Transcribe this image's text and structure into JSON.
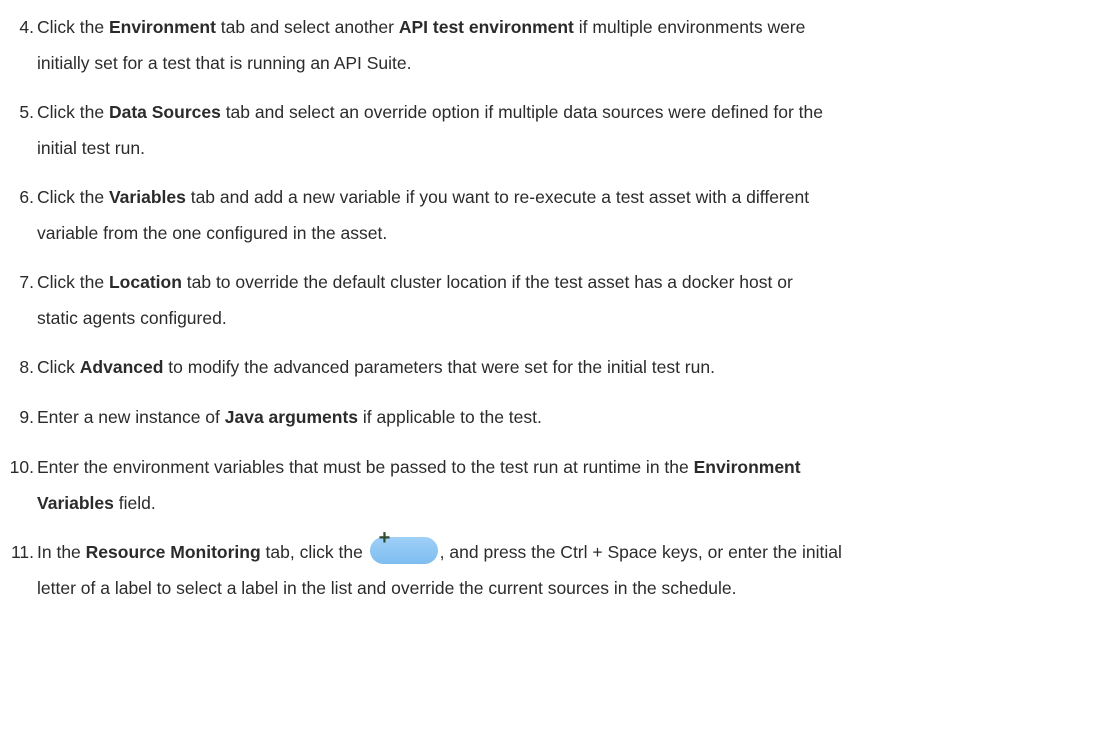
{
  "steps": [
    {
      "number": "4.",
      "lines": [
        [
          {
            "t": "Click the "
          },
          {
            "b": "Environment"
          },
          {
            "t": " tab and select another "
          },
          {
            "b": "API test environment"
          },
          {
            "t": " if multiple environments were"
          }
        ],
        [
          {
            "t": "initially set for a test that is running an API Suite."
          }
        ]
      ]
    },
    {
      "number": "5.",
      "lines": [
        [
          {
            "t": "Click the "
          },
          {
            "b": "Data Sources"
          },
          {
            "t": " tab and select an override option if multiple data sources were defined for the"
          }
        ],
        [
          {
            "t": "initial test run."
          }
        ]
      ]
    },
    {
      "number": "6.",
      "lines": [
        [
          {
            "t": "Click the "
          },
          {
            "b": "Variables"
          },
          {
            "t": " tab and add a new variable if you want to re-execute a test asset with a different"
          }
        ],
        [
          {
            "t": "variable from the one configured in the asset."
          }
        ]
      ]
    },
    {
      "number": "7.",
      "lines": [
        [
          {
            "t": "Click the "
          },
          {
            "b": "Location"
          },
          {
            "t": " tab to override the default cluster location if the test asset has a docker host or"
          }
        ],
        [
          {
            "t": "static agents configured."
          }
        ]
      ]
    },
    {
      "number": "8.",
      "lines": [
        [
          {
            "t": "Click "
          },
          {
            "b": "Advanced"
          },
          {
            "t": " to modify the advanced parameters that were set for the initial test run."
          }
        ]
      ]
    },
    {
      "number": "9.",
      "lines": [
        [
          {
            "t": "Enter a new instance of "
          },
          {
            "b": "Java arguments"
          },
          {
            "t": " if applicable to the test."
          }
        ]
      ]
    },
    {
      "number": "10.",
      "lines": [
        [
          {
            "t": "Enter the environment variables that must be passed to the test run at runtime in the "
          },
          {
            "b": "Environment"
          }
        ],
        [
          {
            "b": "Variables"
          },
          {
            "t": " field."
          }
        ]
      ]
    },
    {
      "number": "11.",
      "lines": [
        [
          {
            "t": "In the "
          },
          {
            "b": "Resource Monitoring"
          },
          {
            "t": " tab, click the "
          },
          {
            "icon": "add-button-icon",
            "glyph": "+"
          },
          {
            "t": ", and press the Ctrl + Space keys, or enter the initial"
          }
        ],
        [
          {
            "t": "letter of a label to select a label in the list and override the current sources in the schedule."
          }
        ]
      ]
    }
  ]
}
